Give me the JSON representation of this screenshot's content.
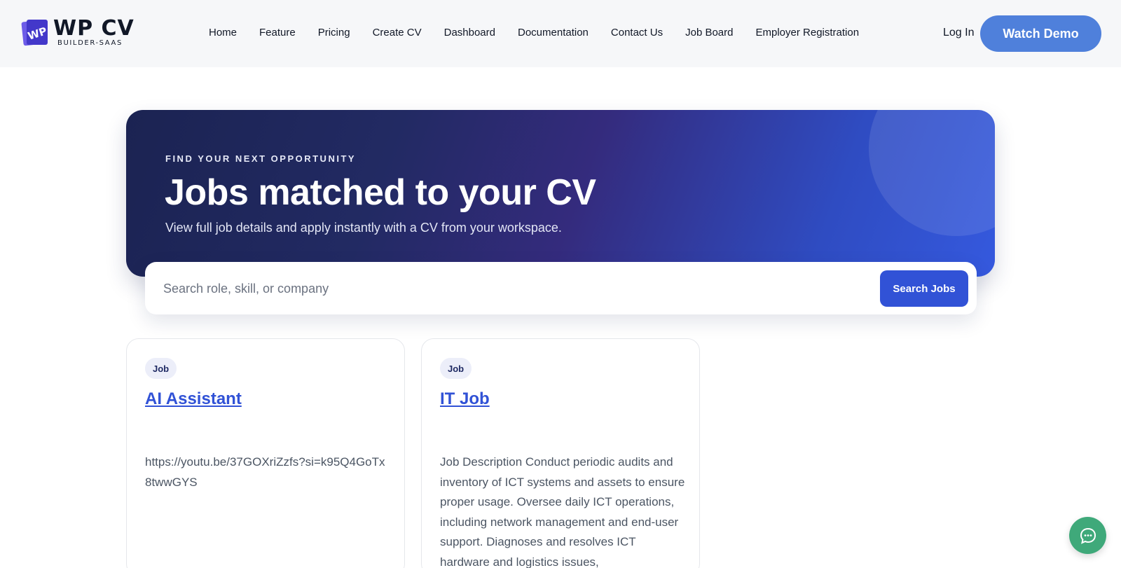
{
  "brand": {
    "mark_letters": "WP",
    "name": "WP CV",
    "tagline": "BUILDER-SAAS",
    "colors": {
      "primary": "#3152d6",
      "mark": "#4338ca",
      "cta": "#4f80db",
      "chat": "#3fa97a"
    }
  },
  "nav": {
    "items": [
      {
        "label": "Home"
      },
      {
        "label": "Feature"
      },
      {
        "label": "Pricing"
      },
      {
        "label": "Create CV"
      },
      {
        "label": "Dashboard"
      },
      {
        "label": "Documentation"
      },
      {
        "label": "Contact Us"
      },
      {
        "label": "Job Board"
      },
      {
        "label": "Employer Registration"
      }
    ],
    "login_label": "Log In",
    "cta_label": "Watch Demo"
  },
  "hero": {
    "eyebrow": "FIND YOUR NEXT OPPORTUNITY",
    "title": "Jobs matched to your CV",
    "subtitle": "View full job details and apply instantly with a CV from your workspace."
  },
  "search": {
    "placeholder": "Search role, skill, or company",
    "value": "",
    "button_label": "Search Jobs",
    "icon": "search-icon"
  },
  "jobs": [
    {
      "badge": "Job",
      "title": "AI Assistant",
      "description": "https://youtu.be/37GOXriZzfs?si=k95Q4GoTx8twwGYS"
    },
    {
      "badge": "Job",
      "title": "IT Job",
      "description": "Job Description Conduct periodic audits and inventory of ICT systems and assets to ensure proper usage. Oversee daily ICT operations, including network management and end-user support. Diagnoses and resolves ICT hardware and logistics issues,"
    }
  ],
  "chat": {
    "icon": "chat-bubble-icon"
  }
}
